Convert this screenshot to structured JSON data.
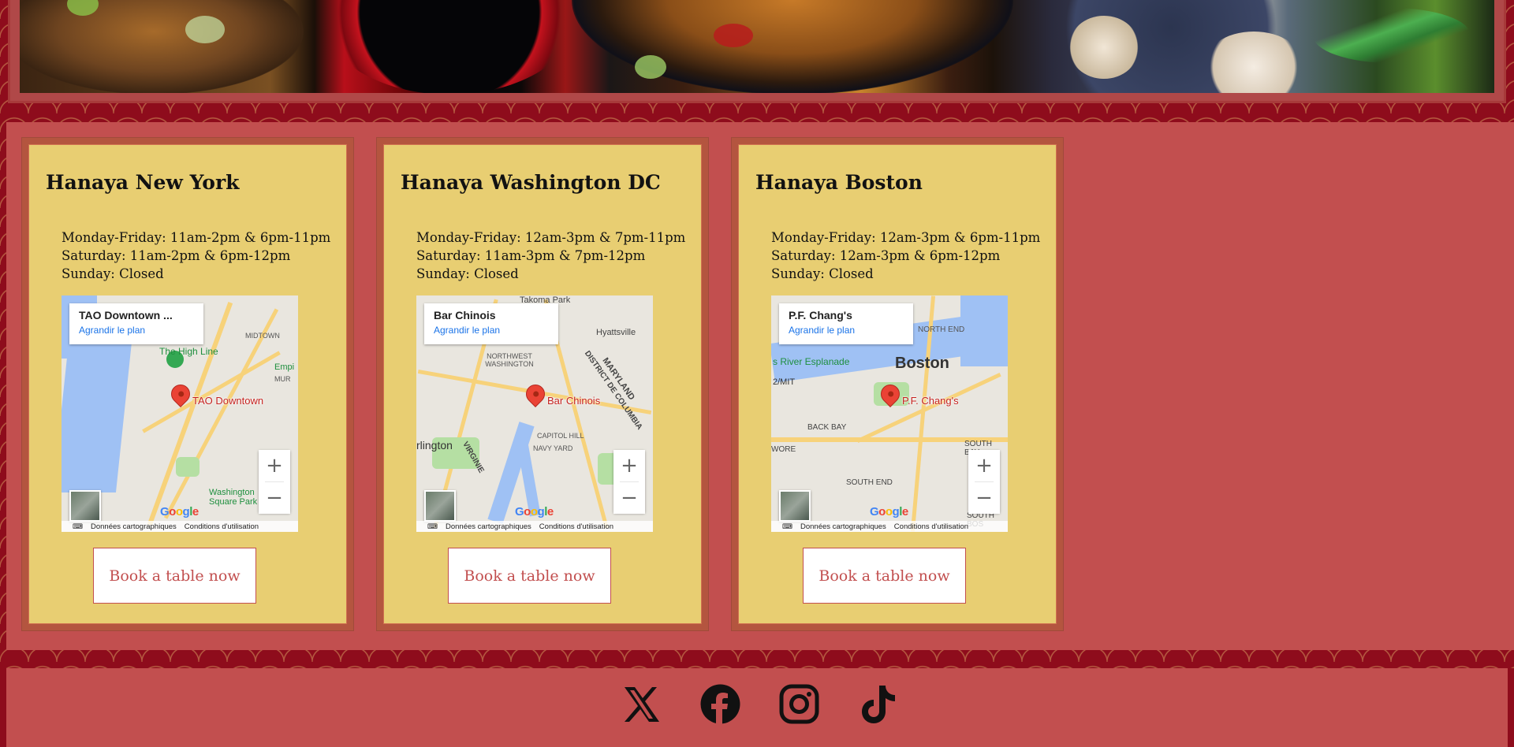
{
  "locations": [
    {
      "name": "Hanaya New York",
      "hours": [
        "Monday-Friday: 11am-2pm & 6pm-11pm",
        "Saturday: 11am-2pm & 6pm-12pm",
        "Sunday: Closed"
      ],
      "map": {
        "place": "TAO Downtown ...",
        "pin_label": "TAO Downtown",
        "expand_link": "Agrandir le plan",
        "labels": [
          "MIDTOWN",
          "The High Line",
          "Washington Square Park",
          "Empi",
          "MUR"
        ]
      },
      "book_label": "Book a table now"
    },
    {
      "name": "Hanaya Washington DC",
      "hours": [
        "Monday-Friday: 12am-3pm & 7pm-11pm",
        "Saturday: 11am-3pm & 7pm-12pm",
        "Sunday: Closed"
      ],
      "map": {
        "place": "Bar Chinois",
        "pin_label": "Bar Chinois",
        "expand_link": "Agrandir le plan",
        "labels": [
          "Takoma Park",
          "Hyattsville",
          "NORTHWEST WASHINGTON",
          "MARYLAND",
          "DISTRICT DE COLUMBIA",
          "CAPITOL HILL",
          "NAVY YARD",
          "rlington",
          "VIRGINIE"
        ]
      },
      "book_label": "Book a table now"
    },
    {
      "name": "Hanaya Boston",
      "hours": [
        "Monday-Friday: 12am-3pm & 6pm-11pm",
        "Saturday: 12am-3pm & 6pm-12pm",
        "Sunday: Closed"
      ],
      "map": {
        "place": "P.F. Chang's",
        "pin_label": "P.F. Chang's",
        "expand_link": "Agrandir le plan",
        "labels": [
          "NORTH END",
          "Boston",
          "s River Esplanade",
          "2/MIT",
          "BACK BAY",
          "SOUTH END",
          "SOUTH BAY",
          "WORE",
          "SOUTH BOS"
        ]
      },
      "book_label": "Book a table now"
    }
  ],
  "map_ui": {
    "zoom_in": "+",
    "zoom_out": "−",
    "keyboard_shortcuts": "⌨",
    "map_data": "Données cartographiques",
    "terms": "Conditions d'utilisation",
    "google_logo": "Google"
  },
  "social": [
    "x-icon",
    "facebook-icon",
    "instagram-icon",
    "tiktok-icon"
  ],
  "colors": {
    "page_background": "#8e0c1c",
    "section_background": "#c24f4f",
    "card_background": "#e8ce72",
    "card_border": "#b4553f",
    "button_text": "#c24f4f"
  }
}
